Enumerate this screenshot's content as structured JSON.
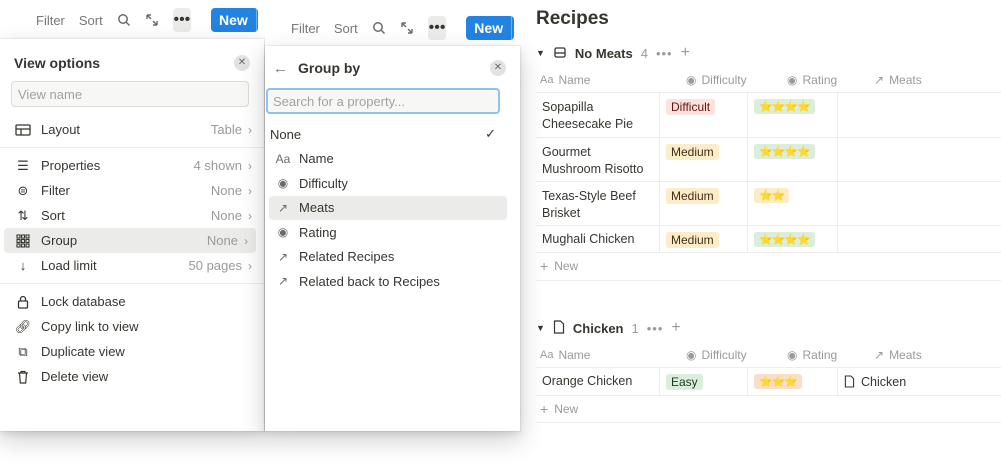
{
  "toolbar_left": {
    "filter": "Filter",
    "sort": "Sort",
    "new": "New"
  },
  "toolbar_mid": {
    "filter": "Filter",
    "sort": "Sort",
    "new": "New"
  },
  "view_options": {
    "title": "View options",
    "view_name_placeholder": "View name",
    "layout": {
      "label": "Layout",
      "value": "Table"
    },
    "properties": {
      "label": "Properties",
      "value": "4 shown"
    },
    "filter": {
      "label": "Filter",
      "value": "None"
    },
    "sort": {
      "label": "Sort",
      "value": "None"
    },
    "group": {
      "label": "Group",
      "value": "None"
    },
    "load_limit": {
      "label": "Load limit",
      "value": "50 pages"
    },
    "lock": "Lock database",
    "copy_link": "Copy link to view",
    "duplicate": "Duplicate view",
    "delete": "Delete view"
  },
  "group_by": {
    "title": "Group by",
    "search_placeholder": "Search for a property...",
    "items": [
      "None",
      "Name",
      "Difficulty",
      "Meats",
      "Rating",
      "Related Recipes",
      "Related back to Recipes"
    ],
    "selected": "None"
  },
  "page": {
    "title": "Recipes",
    "columns": {
      "name": "Name",
      "difficulty": "Difficulty",
      "rating": "Rating",
      "meats": "Meats"
    },
    "new_label": "New",
    "groups": [
      {
        "title": "No Meats",
        "count": "4",
        "rows": [
          {
            "name": "Sopapilla Cheesecake Pie",
            "difficulty": "Difficult",
            "rating": "⭐⭐⭐⭐",
            "meats": ""
          },
          {
            "name": "Gourmet Mushroom Risotto",
            "difficulty": "Medium",
            "rating": "⭐⭐⭐⭐",
            "meats": ""
          },
          {
            "name": "Texas-Style Beef Brisket",
            "difficulty": "Medium",
            "rating": "⭐⭐",
            "meats": ""
          },
          {
            "name": "Mughali Chicken",
            "difficulty": "Medium",
            "rating": "⭐⭐⭐⭐",
            "meats": ""
          }
        ]
      },
      {
        "title": "Chicken",
        "count": "1",
        "rows": [
          {
            "name": "Orange Chicken",
            "difficulty": "Easy",
            "rating": "⭐⭐⭐",
            "meats": "Chicken"
          }
        ]
      }
    ]
  },
  "colors": {
    "accent": "#2383e2",
    "hover": "#ebebea"
  }
}
